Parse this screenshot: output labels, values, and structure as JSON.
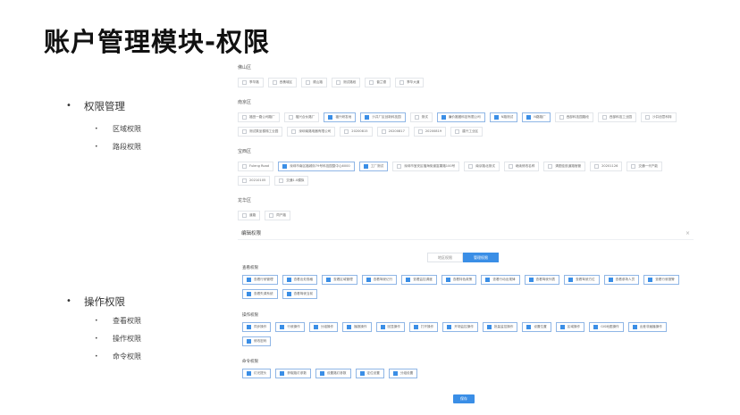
{
  "slide": {
    "title": "账户管理模块-权限"
  },
  "outline": {
    "section1": {
      "label": "权限管理",
      "items": [
        "区域权限",
        "路段权限"
      ]
    },
    "section2": {
      "label": "操作权限",
      "items": [
        "查看权限",
        "操作权限",
        "命令权限"
      ]
    }
  },
  "regions": [
    {
      "name": "佛山区",
      "chips": [
        {
          "label": "季华路",
          "checked": false
        },
        {
          "label": "西樵城区",
          "checked": false
        },
        {
          "label": "顺山路",
          "checked": false
        },
        {
          "label": "测试路段",
          "checked": false
        },
        {
          "label": "普兰德",
          "checked": false
        },
        {
          "label": "季华大道",
          "checked": false
        }
      ]
    },
    {
      "name": "南京区",
      "chips": [
        {
          "label": "福田一路公司路厂",
          "checked": false
        },
        {
          "label": "福兴合伙路厂",
          "checked": false
        },
        {
          "label": "福兴研发地",
          "checked": true
        },
        {
          "label": "沙井厂区创新科技园",
          "checked": true
        },
        {
          "label": "测试",
          "checked": false
        },
        {
          "label": "廉价搬搬科技有限公司",
          "checked": true
        },
        {
          "label": "N路测试",
          "checked": true
        },
        {
          "label": "N路路厂",
          "checked": true
        },
        {
          "label": "西部科技园路段",
          "checked": false
        },
        {
          "label": "西部科技工业园",
          "checked": false
        },
        {
          "label": "沙井创意科特",
          "checked": false
        },
        {
          "label": "测试乘坐楼梯工业园",
          "checked": false
        },
        {
          "label": "深圳南路电器有限公司",
          "checked": false
        },
        {
          "label": "20200815",
          "checked": false
        },
        {
          "label": "20200817",
          "checked": false
        },
        {
          "label": "20200819",
          "checked": false
        },
        {
          "label": "建兴工业区",
          "checked": false
        }
      ]
    },
    {
      "name": "宝西区",
      "chips": [
        {
          "label": "Fuleng Road",
          "checked": false
        },
        {
          "label": "深圳市南区福城街79号科技园整中心6000",
          "checked": true
        },
        {
          "label": "工厂测试",
          "checked": true
        },
        {
          "label": "深圳市宝安区福海街道富康路100号",
          "checked": false
        },
        {
          "label": "南京路北测试",
          "checked": false
        },
        {
          "label": "继续修改名称",
          "checked": false
        },
        {
          "label": "清图佳航道路宿管",
          "checked": false
        },
        {
          "label": "20201126",
          "checked": false
        },
        {
          "label": "交通一代产能",
          "checked": false
        },
        {
          "label": "20210105",
          "checked": false
        },
        {
          "label": "交通1.0模拟",
          "checked": false
        }
      ]
    },
    {
      "name": "龙华区",
      "chips": [
        {
          "label": "道路",
          "checked": false
        },
        {
          "label": "同产路",
          "checked": false
        }
      ]
    }
  ],
  "panel": {
    "title": "编辑权限",
    "close": "×",
    "tabs": [
      {
        "label": "地区权限",
        "active": false
      },
      {
        "label": "管理权限",
        "active": true
      }
    ],
    "groups": [
      {
        "title": "查看权限",
        "items": [
          "查看行驶管理",
          "查看出处规格",
          "查看区域管理",
          "查看驾驶记行",
          "查看监控调度",
          "查看特色政策",
          "查看行动出规律",
          "查看驾驶列表",
          "查看驾驶方位",
          "查看参场人员",
          "查看行驶报警",
          "查看失调系统",
          "查看驾驶当前"
        ]
      },
      {
        "title": "操作权限",
        "items": [
          "同步操作",
          "行驶操作",
          "分组操作",
          "播报操作",
          "回显操作",
          "打开操作",
          "开场监控操作",
          "批量监控操作",
          "设置位置",
          "区域操作",
          "GIS地图操作",
          "出差非遍播操作",
          "修改密码"
        ]
      },
      {
        "title": "命令权限",
        "items": [
          "灯光提头",
          "获取路灯参数",
          "设置路灯参数",
          "定位设置",
          "分组设置"
        ]
      }
    ],
    "save_label": "保存"
  }
}
